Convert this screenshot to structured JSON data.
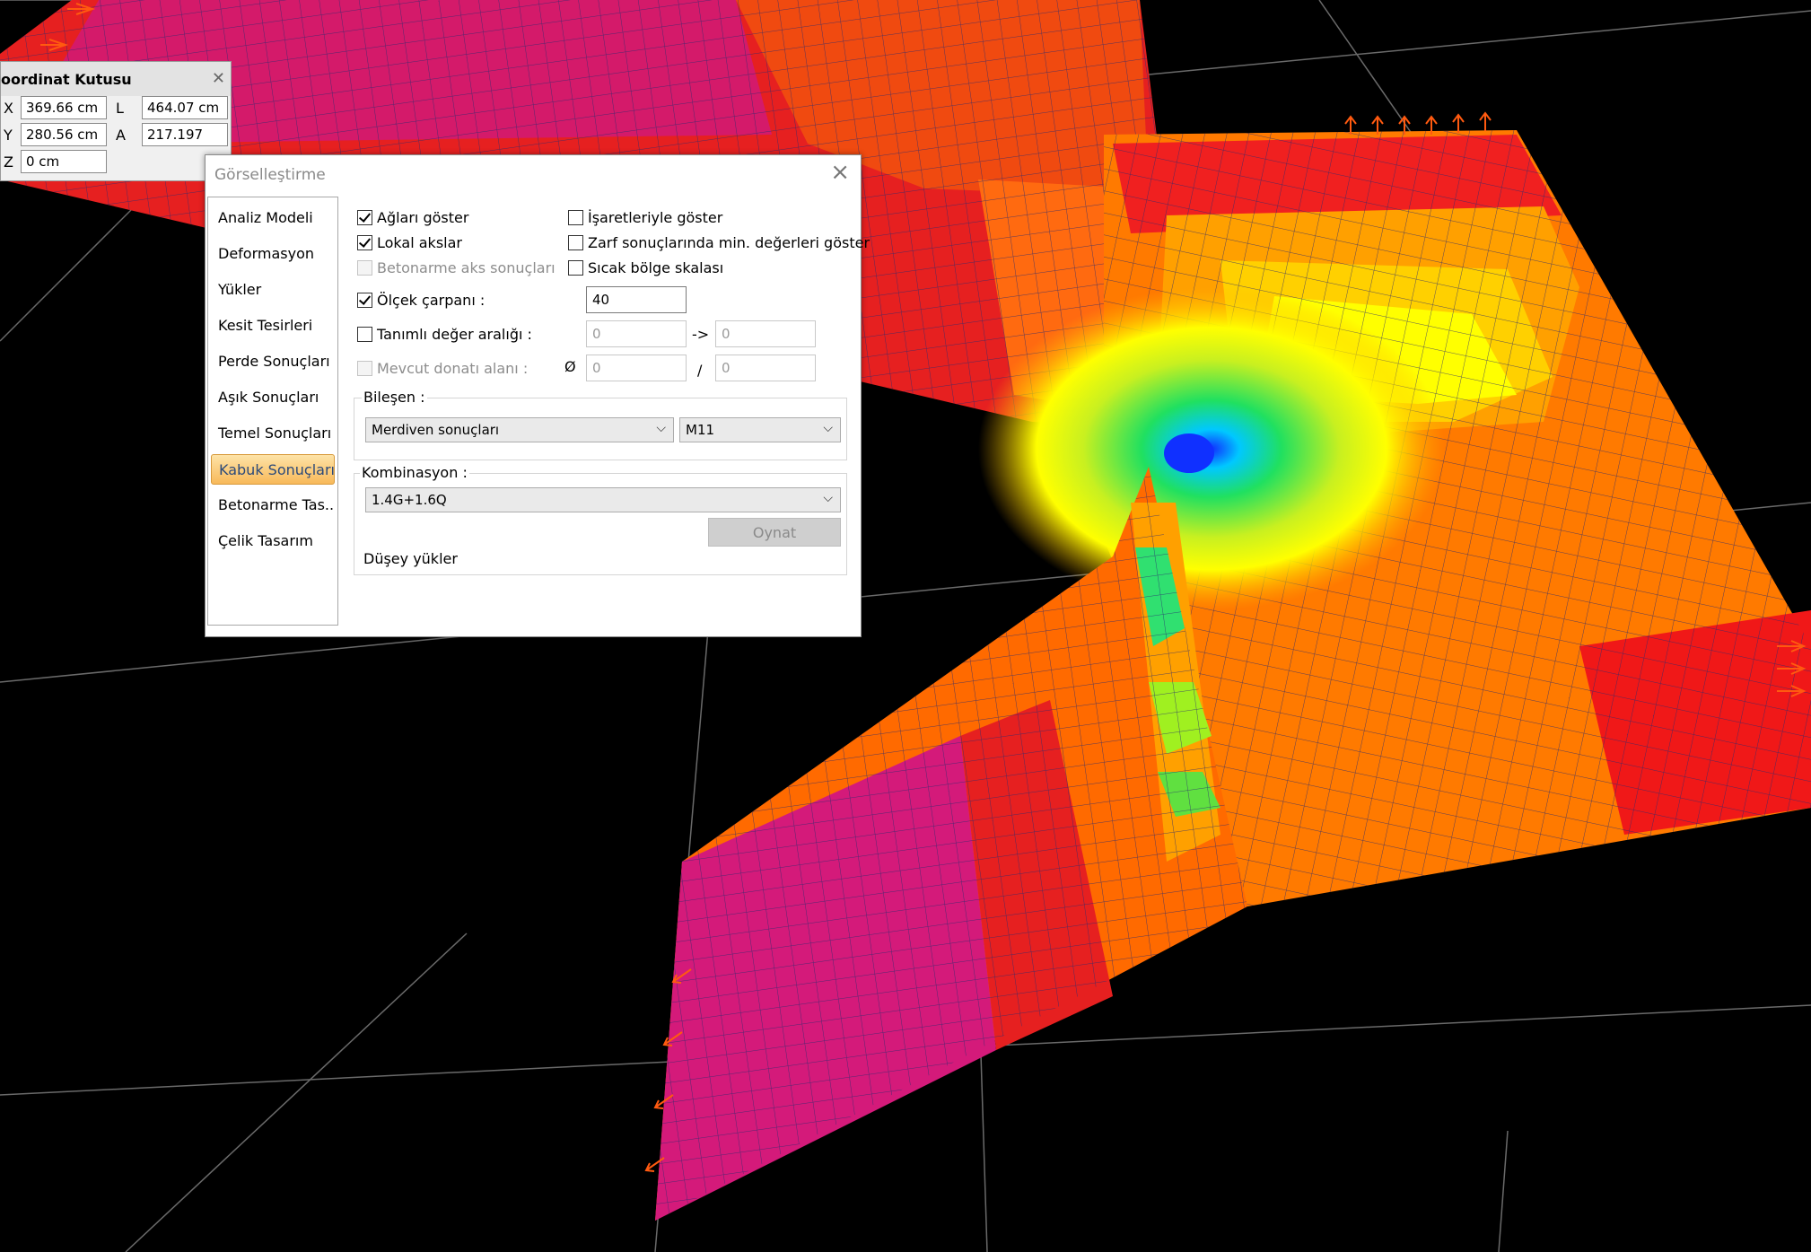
{
  "coordinate_box": {
    "title": "oordinat Kutusu",
    "x_label": "X",
    "x_value": "369.66 cm",
    "y_label": "Y",
    "y_value": "280.56 cm",
    "z_label": "Z",
    "z_value": "0 cm",
    "l_label": "L",
    "l_value": "464.07 cm",
    "a_label": "A",
    "a_value": "217.197"
  },
  "dialog": {
    "title": "Görselleştirme",
    "nav": [
      "Analiz Modeli",
      "Deformasyon",
      "Yükler",
      "Kesit Tesirleri",
      "Perde Sonuçları",
      "Aşık Sonuçları",
      "Temel Sonuçları",
      "Kabuk Sonuçları",
      "Betonarme Tas...",
      "Çelik Tasarım"
    ],
    "active_nav": "Kabuk Sonuçları",
    "options": {
      "show_mesh": "Ağları göster",
      "local_axes": "Lokal akslar",
      "rc_axis_results": "Betonarme aks sonuçları",
      "scale_factor": "Ölçek çarpanı :",
      "scale_factor_value": "40",
      "defined_range": "Tanımlı değer aralığı :",
      "range_from": "0",
      "range_arrow": "->",
      "range_to": "0",
      "existing_rebar": "Mevcut donatı alanı :",
      "diameter_symbol": "Ø",
      "rebar_diameter": "0",
      "slash": "/",
      "rebar_spacing": "0",
      "show_with_signs": "İşaretleriyle göster",
      "envelope_min": "Zarf sonuçlarında min. değerleri göster",
      "hot_zone_scale": "Sıcak bölge skalası"
    },
    "component": {
      "label": "Bileşen :",
      "result_type": "Merdiven sonuçları",
      "component_value": "M11"
    },
    "combination": {
      "label": "Kombinasyon :",
      "value": "1.4G+1.6Q",
      "play_button": "Oynat",
      "description": "Düşey yükler"
    }
  }
}
